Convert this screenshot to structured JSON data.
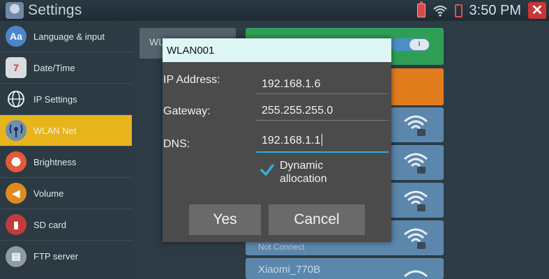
{
  "statusbar": {
    "title": "Settings",
    "time": "3:50 PM"
  },
  "sidebar": {
    "items": [
      {
        "label": "Language & input",
        "icon": "language-icon"
      },
      {
        "label": "Date/Time",
        "icon": "calendar-clock-icon"
      },
      {
        "label": "IP Settings",
        "icon": "globe-icon"
      },
      {
        "label": "WLAN Net",
        "icon": "wifi-antenna-icon",
        "active": true
      },
      {
        "label": "Brightness",
        "icon": "brightness-icon"
      },
      {
        "label": "Volume",
        "icon": "speaker-icon"
      },
      {
        "label": "SD card",
        "icon": "sd-card-icon"
      },
      {
        "label": "FTP server",
        "icon": "ftp-server-icon"
      }
    ]
  },
  "main": {
    "tab_label": "WLAN Net",
    "networks": [
      {
        "status": "Not Connect"
      },
      {
        "name": "Xiaomi_770B"
      }
    ]
  },
  "dialog": {
    "title": "WLAN001",
    "ip_label": "IP Address:",
    "ip_value": "192.168.1.6",
    "gateway_label": "Gateway:",
    "gateway_value": "255.255.255.0",
    "dns_label": "DNS:",
    "dns_value": "192.168.1.1",
    "dynamic_line1": "Dynamic",
    "dynamic_line2": "allocation",
    "dynamic_checked": true,
    "yes_label": "Yes",
    "cancel_label": "Cancel"
  },
  "colors": {
    "accent_active": "#e8b41c",
    "focus_line": "#3da8d6",
    "panel_green": "#2f9f55",
    "panel_orange": "#e07c1c",
    "tile_blue": "#5b87ad"
  }
}
